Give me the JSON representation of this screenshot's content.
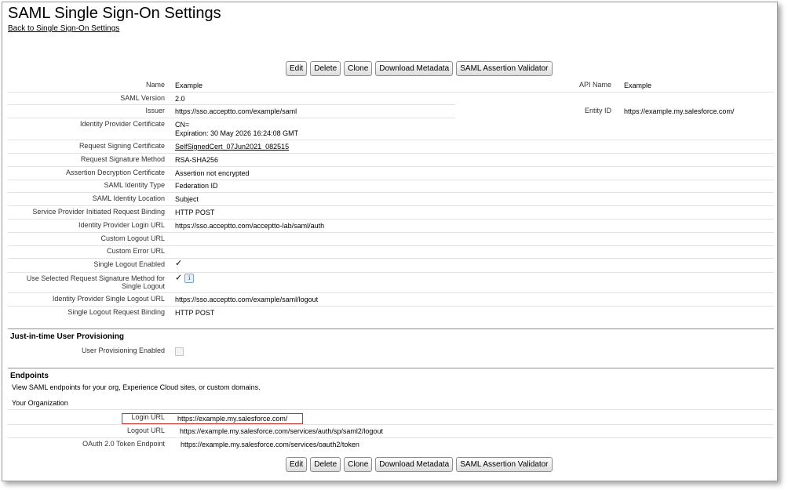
{
  "page": {
    "title": "SAML Single Sign-On Settings",
    "back_link": "Back to Single Sign-On Settings"
  },
  "buttons": {
    "edit": "Edit",
    "delete": "Delete",
    "clone": "Clone",
    "download_metadata": "Download Metadata",
    "validator": "SAML Assertion Validator"
  },
  "details": {
    "name_label": "Name",
    "name_value": "Example",
    "api_name_label": "API Name",
    "api_name_value": "Example",
    "saml_version_label": "SAML Version",
    "saml_version_value": "2.0",
    "issuer_label": "Issuer",
    "issuer_value": "https://sso.acceptto.com/example/saml",
    "entity_id_label": "Entity ID",
    "entity_id_value": "https://example.my.salesforce.com/",
    "idp_cert_label": "Identity Provider Certificate",
    "idp_cert_value_line1": "CN=",
    "idp_cert_value_line2": "Expiration: 30 May 2026 16:24:08 GMT",
    "req_sign_cert_label": "Request Signing Certificate",
    "req_sign_cert_value": "SelfSignedCert_07Jun2021_082515",
    "req_sig_method_label": "Request Signature Method",
    "req_sig_method_value": "RSA-SHA256",
    "assert_decrypt_label": "Assertion Decryption Certificate",
    "assert_decrypt_value": "Assertion not encrypted",
    "identity_type_label": "SAML Identity Type",
    "identity_type_value": "Federation ID",
    "identity_location_label": "SAML Identity Location",
    "identity_location_value": "Subject",
    "sp_binding_label": "Service Provider Initiated Request Binding",
    "sp_binding_value": "HTTP POST",
    "idp_login_url_label": "Identity Provider Login URL",
    "idp_login_url_value": "https://sso.acceptto.com/acceptto-lab/saml/auth",
    "custom_logout_label": "Custom Logout URL",
    "custom_error_label": "Custom Error URL",
    "single_logout_enabled_label": "Single Logout Enabled",
    "use_selected_sig_label_1": "Use Selected Request Signature Method for",
    "use_selected_sig_label_2": "Single Logout",
    "idp_single_logout_label": "Identity Provider Single Logout URL",
    "idp_single_logout_value": "https://sso.acceptto.com/example/saml/logout",
    "single_logout_binding_label": "Single Logout Request Binding",
    "single_logout_binding_value": "HTTP POST",
    "check_mark": "✓"
  },
  "jit": {
    "heading": "Just-in-time User Provisioning",
    "user_provisioning_label": "User Provisioning Enabled"
  },
  "endpoints": {
    "heading": "Endpoints",
    "description": "View SAML endpoints for your org, Experience Cloud sites, or custom domains.",
    "your_org": "Your Organization",
    "login_url_label": "Login URL",
    "login_url_value": "https://example.my.salesforce.com/",
    "logout_url_label": "Logout URL",
    "logout_url_value": "https://example.my.salesforce.com/services/auth/sp/saml2/logout",
    "oauth_label": "OAuth 2.0 Token Endpoint",
    "oauth_value": "https://example.my.salesforce.com/services/oauth2/token"
  },
  "colors": {
    "highlight": "#c83232",
    "border": "#8f8f8f"
  }
}
